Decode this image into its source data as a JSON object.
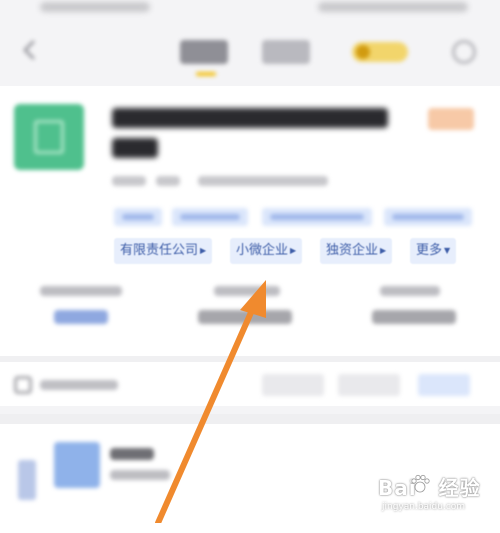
{
  "company": {
    "tags": [
      {
        "label": "有限责任公司"
      },
      {
        "label": "小微企业"
      },
      {
        "label": "独资企业"
      },
      {
        "label": "更多"
      }
    ]
  },
  "watermark": {
    "brand": "Bai",
    "brand_suffix": "经验",
    "url": "jingyan.baidu.com"
  },
  "colors": {
    "accent_tab_underline": "#f3c21a",
    "logo_green": "#4fc08d",
    "tag_text_blue": "#3d5da8",
    "tag_bg": "#e7eefc",
    "arrow_orange": "#f08a2e"
  },
  "icons": {
    "back": "back-arrow-icon",
    "more": "more-icon",
    "phone": "phone-icon",
    "tag_arrow": "triangle-right-icon",
    "more_dropdown": "triangle-down-icon",
    "watermark_logo": "baidu-paw-icon"
  }
}
